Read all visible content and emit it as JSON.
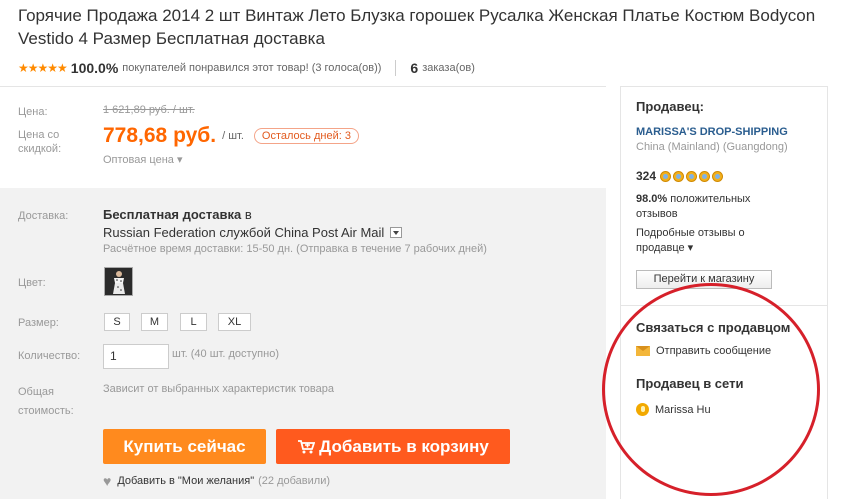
{
  "product": {
    "title": "Горячие Продажа 2014 2 шт Винтаж Лето Блузка горошек Русалка Женская Платье Костюм Bodycon Vestido 4 Размер Бесплатная доставка"
  },
  "rating": {
    "stars": "★★★★★",
    "percent": "100.0%",
    "text": "покупателей понравился этот товар! (3 голоса(ов))",
    "orders_count": "6",
    "orders_label": "заказа(ов)"
  },
  "price": {
    "label": "Цена:",
    "old_value": "1 621,89 руб. / шт.",
    "discount_label": "Цена со скидкой:",
    "new_value": "778,68 руб.",
    "unit": "/ шт.",
    "days_left": "Осталось дней: 3",
    "wholesale": "Оптовая цена ▾"
  },
  "shipping": {
    "label": "Доставка:",
    "free": "Бесплатная доставка",
    "to": "в",
    "method": "Russian Federation службой China Post Air Mail",
    "time": "Расчётное время доставки: 15-50 дн. (Отправка в течение 7 рабочих дней)"
  },
  "options": {
    "color_label": "Цвет:",
    "size_label": "Размер:",
    "sizes": [
      "S",
      "M",
      "L",
      "XL"
    ],
    "quantity_label": "Количество:",
    "quantity_value": "1",
    "quantity_note": "шт. (40 шт. доступно)",
    "total_label": "Общая стоимость:",
    "total_note": "Зависит от выбранных характеристик товара"
  },
  "actions": {
    "buy_now": "Купить сейчас",
    "add_to_cart": "Добавить в корзину",
    "wishlist": "Добавить в \"Мои желания\"",
    "wishlist_count": "(22 добавили)"
  },
  "seller": {
    "heading": "Продавец:",
    "store_name": "MARISSA'S DROP-SHIPPING",
    "location": "China (Mainland) (Guangdong)",
    "score": "324",
    "positive_pct": "98.0%",
    "positive_text": "положительных отзывов",
    "detailed": "Подробные отзывы о продавце ▾",
    "go_store": "Перейти к магазину",
    "contact_heading": "Связаться с продавцом",
    "send_message": "Отправить сообщение",
    "online_heading": "Продавец в сети",
    "online_user": "Marissa Hu"
  },
  "colors": {
    "accent_orange": "#ff8a1e",
    "cart_orange": "#ff5a1e",
    "price_orange": "#ff6600",
    "highlight_circle": "#d6202a",
    "store_link": "#2a5d8f"
  }
}
